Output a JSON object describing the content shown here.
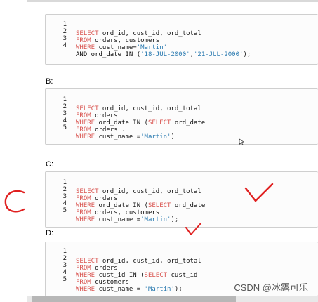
{
  "options": [
    {
      "label": ""
    },
    {
      "label": "B:"
    },
    {
      "label": "C:"
    },
    {
      "label": "D:"
    }
  ],
  "code_blocks": [
    {
      "lines": [
        "1",
        "2",
        "3",
        "4"
      ],
      "code": [
        [],
        [
          {
            "t": "SELECT",
            "c": "kw"
          },
          {
            "t": " ord_id, cust_id, ord_total",
            "c": ""
          }
        ],
        [
          {
            "t": "FROM",
            "c": "kw"
          },
          {
            "t": " orders, customers",
            "c": ""
          }
        ],
        [
          {
            "t": "WHERE",
            "c": "kw"
          },
          {
            "t": " cust_name=",
            "c": ""
          },
          {
            "t": "'Martin'",
            "c": "str"
          }
        ],
        [
          {
            "t": "AND ord_date IN (",
            "c": ""
          },
          {
            "t": "'18-JUL-2000'",
            "c": "str"
          },
          {
            "t": ",",
            "c": ""
          },
          {
            "t": "'21-JUL-2000'",
            "c": "str"
          },
          {
            "t": ");",
            "c": ""
          }
        ]
      ]
    },
    {
      "lines": [
        "1",
        "2",
        "3",
        "4",
        "5"
      ],
      "code": [
        [],
        [
          {
            "t": "SELECT",
            "c": "kw"
          },
          {
            "t": " ord_id, cust_id, ord_total",
            "c": ""
          }
        ],
        [
          {
            "t": "FROM",
            "c": "kw"
          },
          {
            "t": " orders",
            "c": ""
          }
        ],
        [
          {
            "t": "WHERE",
            "c": "kw"
          },
          {
            "t": " ord_date IN (",
            "c": ""
          },
          {
            "t": "SELECT",
            "c": "kw"
          },
          {
            "t": " ord_date",
            "c": ""
          }
        ],
        [
          {
            "t": "FROM",
            "c": "kw"
          },
          {
            "t": " orders .",
            "c": ""
          }
        ],
        [
          {
            "t": "WHERE",
            "c": "kw"
          },
          {
            "t": " cust_name =",
            "c": ""
          },
          {
            "t": "'Martin'",
            "c": "str"
          },
          {
            "t": ")",
            "c": ""
          }
        ]
      ]
    },
    {
      "lines": [
        "1",
        "2",
        "3",
        "4",
        "5"
      ],
      "code": [
        [],
        [
          {
            "t": "SELECT",
            "c": "kw"
          },
          {
            "t": " ord_id, cust_id, ord_total",
            "c": ""
          }
        ],
        [
          {
            "t": "FROM",
            "c": "kw"
          },
          {
            "t": " orders",
            "c": ""
          }
        ],
        [
          {
            "t": "WHERE",
            "c": "kw"
          },
          {
            "t": " ord_date IN (",
            "c": ""
          },
          {
            "t": "SELECT",
            "c": "kw"
          },
          {
            "t": " ord_date",
            "c": ""
          }
        ],
        [
          {
            "t": "FROM",
            "c": "kw"
          },
          {
            "t": " orders, customers",
            "c": ""
          }
        ],
        [
          {
            "t": "WHERE",
            "c": "kw"
          },
          {
            "t": " cust_name =",
            "c": ""
          },
          {
            "t": "'Martin'",
            "c": "str"
          },
          {
            "t": ");",
            "c": ""
          }
        ]
      ]
    },
    {
      "lines": [
        "1",
        "2",
        "3",
        "4",
        "5"
      ],
      "code": [
        [],
        [
          {
            "t": "SELECT",
            "c": "kw"
          },
          {
            "t": " ord_id, cust_id, ord_total",
            "c": ""
          }
        ],
        [
          {
            "t": "FROM",
            "c": "kw"
          },
          {
            "t": " orders",
            "c": ""
          }
        ],
        [
          {
            "t": "WHERE",
            "c": "kw"
          },
          {
            "t": " cust_id IN (",
            "c": ""
          },
          {
            "t": "SELECT",
            "c": "kw"
          },
          {
            "t": " cust_id",
            "c": ""
          }
        ],
        [
          {
            "t": "FROM",
            "c": "kw"
          },
          {
            "t": " customers",
            "c": ""
          }
        ],
        [
          {
            "t": "WHERE",
            "c": "kw"
          },
          {
            "t": " cust_name = ",
            "c": ""
          },
          {
            "t": "'Martin'",
            "c": "str"
          },
          {
            "t": ");",
            "c": ""
          }
        ]
      ]
    }
  ],
  "watermark": "CSDN @冰露可乐",
  "colors": {
    "keyword": "#d9534f",
    "string": "#2a7ab0",
    "annotation": "#e02020"
  }
}
